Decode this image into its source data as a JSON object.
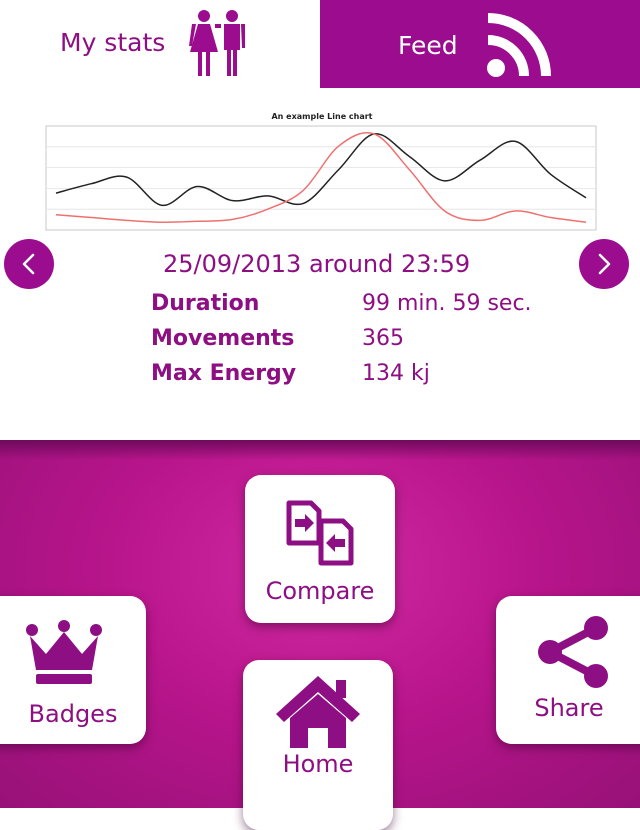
{
  "tabs": {
    "mystats_label": "My stats",
    "feed_label": "Feed",
    "mystats_icon": "couple-icon",
    "feed_icon": "rss-feed-icon"
  },
  "colors": {
    "accent": "#9b0d8e",
    "text": "#8d0f83",
    "gradient_light": "#d12aa2",
    "gradient_dark": "#971178"
  },
  "chart_data": {
    "type": "line",
    "title": "An example Line chart",
    "xlabel": "",
    "ylabel": "",
    "grid": true,
    "series": [
      {
        "color": "#222222",
        "values": [
          0.35,
          0.45,
          0.52,
          0.22,
          0.42,
          0.27,
          0.32,
          0.24,
          0.6,
          0.98,
          0.74,
          0.48,
          0.7,
          0.9,
          0.55,
          0.3
        ]
      },
      {
        "color": "#f07070",
        "values": [
          0.12,
          0.09,
          0.06,
          0.04,
          0.05,
          0.07,
          0.18,
          0.38,
          0.85,
          0.98,
          0.6,
          0.16,
          0.06,
          0.16,
          0.09,
          0.04
        ]
      }
    ],
    "ylim": [
      0,
      1
    ]
  },
  "navigation": {
    "prev_icon": "chevron-left-icon",
    "next_icon": "chevron-right-icon"
  },
  "session": {
    "date": "25/09/2013 around 23:59",
    "stats": [
      {
        "label": "Duration",
        "value": "99 min. 59 sec."
      },
      {
        "label": "Movements",
        "value": "365"
      },
      {
        "label": "Max Energy",
        "value": "134 kj"
      }
    ]
  },
  "actions": {
    "compare_label": "Compare",
    "badges_label": "Badges",
    "share_label": "Share",
    "home_label": "Home"
  }
}
